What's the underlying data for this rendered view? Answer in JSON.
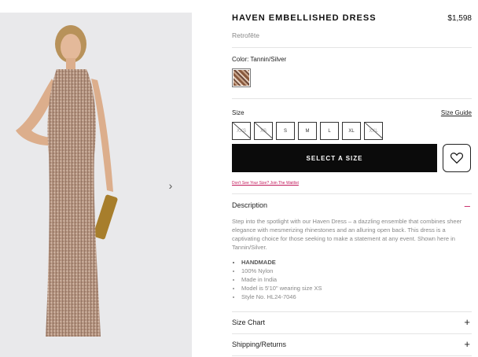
{
  "product": {
    "title": "HAVEN EMBELLISHED DRESS",
    "price": "$1,598",
    "brand": "Retrofête",
    "color_label": "Color: Tannin/Silver",
    "size_label": "Size",
    "size_guide": "Size Guide",
    "sizes": [
      {
        "label": "XXS",
        "available": false
      },
      {
        "label": "XS",
        "available": false
      },
      {
        "label": "S",
        "available": true
      },
      {
        "label": "M",
        "available": true
      },
      {
        "label": "L",
        "available": true
      },
      {
        "label": "XL",
        "available": true
      },
      {
        "label": "XXL",
        "available": false
      }
    ],
    "select_button": "SELECT A SIZE",
    "waitlist_link": "Don't See Your Size? Join The Waitlist"
  },
  "description": {
    "title": "Description",
    "text": "Step into the spotlight with our Haven Dress – a dazzling ensemble that combines sheer elegance with mesmerizing rhinestones and an alluring open back. This dress is a captivating choice for those seeking to make a statement at any event. Shown here in Tannin/Silver.",
    "details": [
      "HANDMADE",
      "100% Nylon",
      "Made in India",
      "Model is 5'10\" wearing size XS",
      "Style No. HL24-7046"
    ]
  },
  "accordions": {
    "size_chart": "Size Chart",
    "shipping": "Shipping/Returns"
  },
  "icons": {
    "next": "chevron-right-icon",
    "wishlist": "heart-icon",
    "expand": "plus-icon",
    "collapse": "minus-icon"
  },
  "colors": {
    "accent": "#c2185b",
    "button": "#0b0b0b",
    "gallery_bg": "#e9e9eb"
  }
}
